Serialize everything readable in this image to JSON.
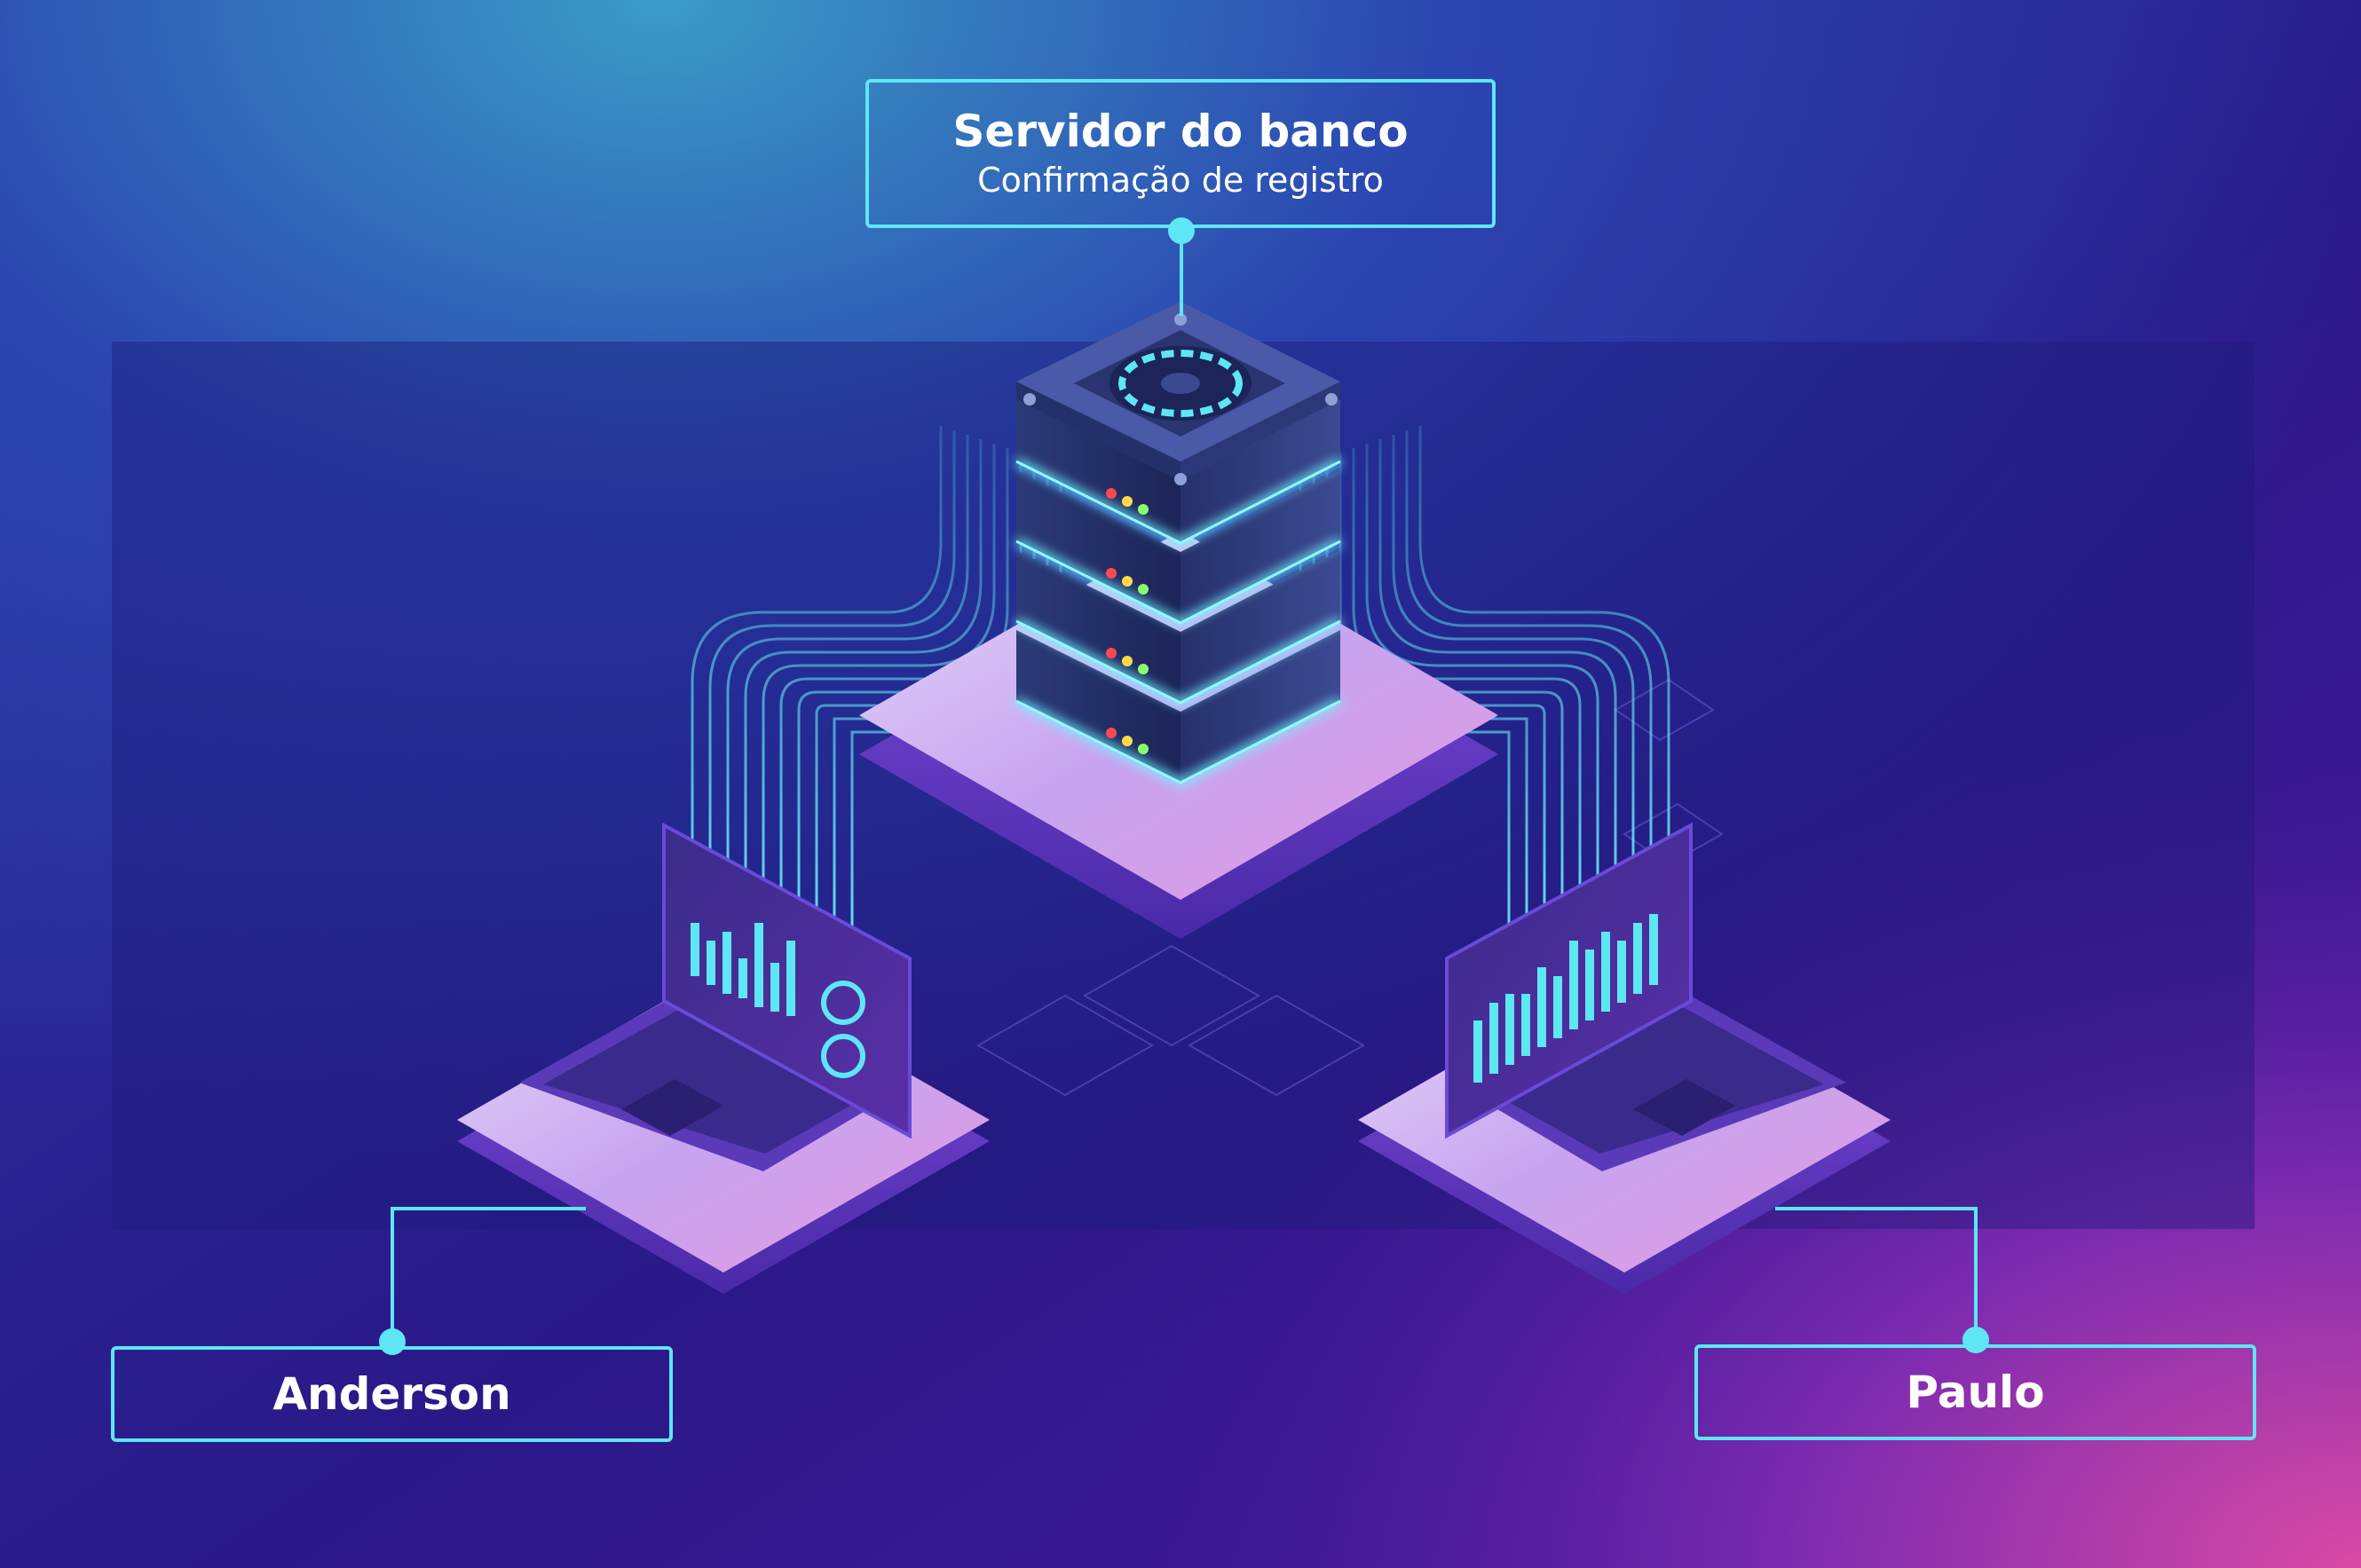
{
  "server_node": {
    "title": "Servidor do banco",
    "subtitle": "Confirmação de registro"
  },
  "client_nodes": [
    {
      "label": "Anderson"
    },
    {
      "label": "Paulo"
    }
  ],
  "colors": {
    "connector": "#5ee6f5",
    "glow": "#3ef0f5",
    "background_top": "#2e8fc0",
    "background_mid": "#2a1c8e",
    "background_accent": "#d14aa8"
  },
  "icons": [
    "server-rack-icon",
    "laptop-icon",
    "laptop-icon"
  ]
}
